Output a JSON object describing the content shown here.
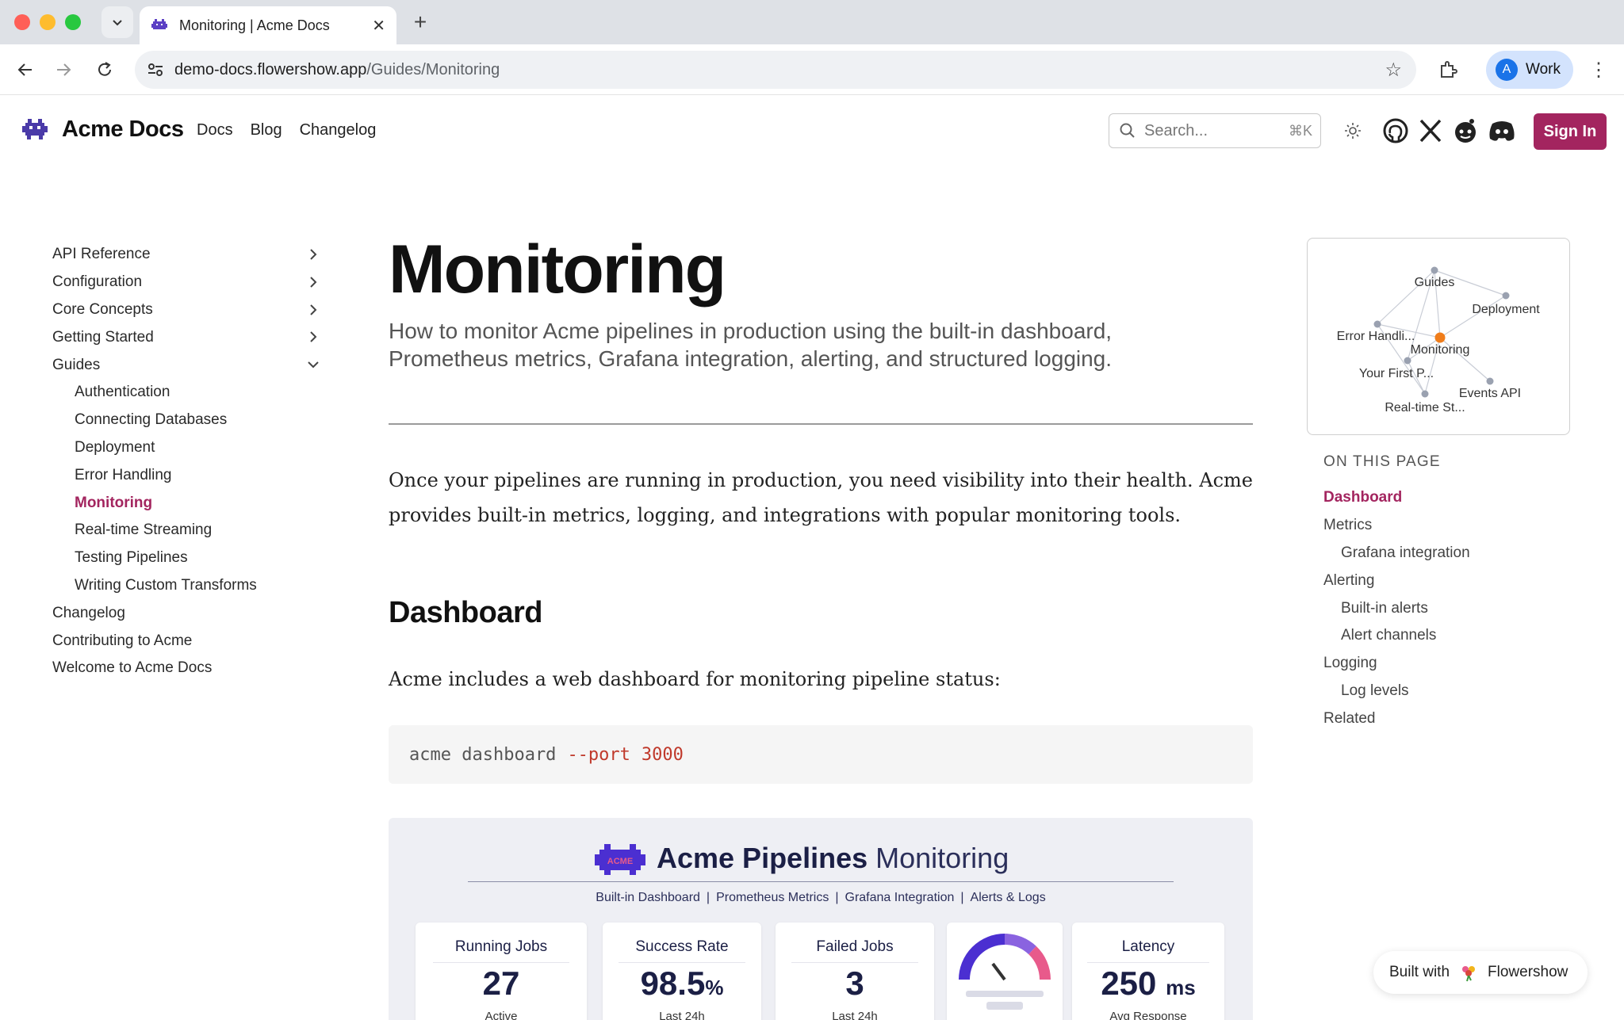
{
  "browser": {
    "tab_title": "Monitoring | Acme Docs",
    "url_host": "demo-docs.flowershow.app",
    "url_path": "/Guides/Monitoring",
    "profile_initial": "A",
    "profile_name": "Work"
  },
  "header": {
    "brand": "Acme Docs",
    "nav": [
      "Docs",
      "Blog",
      "Changelog"
    ],
    "search_placeholder": "Search...",
    "search_shortcut": "⌘K",
    "signin_label": "Sign In",
    "accent_color": "#a3255f"
  },
  "sidebar": {
    "items": [
      {
        "label": "API Reference",
        "chevron": "right"
      },
      {
        "label": "Configuration",
        "chevron": "right"
      },
      {
        "label": "Core Concepts",
        "chevron": "right"
      },
      {
        "label": "Getting Started",
        "chevron": "right"
      },
      {
        "label": "Guides",
        "chevron": "down"
      }
    ],
    "guides": [
      "Authentication",
      "Connecting Databases",
      "Deployment",
      "Error Handling",
      "Monitoring",
      "Real-time Streaming",
      "Testing Pipelines",
      "Writing Custom Transforms"
    ],
    "bottom": [
      "Changelog",
      "Contributing to Acme",
      "Welcome to Acme Docs"
    ]
  },
  "main": {
    "title": "Monitoring",
    "description": "How to monitor Acme pipelines in production using the built-in dashboard, Prometheus metrics, Grafana integration, alerting, and structured logging.",
    "lead": "Once your pipelines are running in production, you need visibility into their health. Acme provides built-in metrics, logging, and integrations with popular monitoring tools.",
    "h2_dashboard": "Dashboard",
    "dashboard_para": "Acme includes a web dashboard for monitoring pipeline status:",
    "code": {
      "cmd": "acme dashboard",
      "flag": "--port",
      "value": "3000"
    }
  },
  "banner": {
    "logo_text": "ACME",
    "title_bold": "Acme Pipelines",
    "title_rest": "Monitoring",
    "links": [
      "Built-in Dashboard",
      "Prometheus Metrics",
      "Grafana Integration",
      "Alerts & Logs"
    ],
    "cards": [
      {
        "title": "Running Jobs",
        "value": "27",
        "unit": "",
        "sub": "Active"
      },
      {
        "title": "Success Rate",
        "value": "98.5",
        "unit": "%",
        "sub": "Last 24h"
      },
      {
        "title": "Failed Jobs",
        "value": "3",
        "unit": "",
        "sub": "Last 24h"
      },
      {
        "title": "Latency",
        "value": "250",
        "unit": "ms",
        "sub": "Avg Response"
      }
    ]
  },
  "graph": {
    "nodes": [
      "Guides",
      "Deployment",
      "Error Handli...",
      "Monitoring",
      "Your First P...",
      "Events API",
      "Real-time St..."
    ]
  },
  "toc": {
    "heading": "ON THIS PAGE",
    "items": [
      {
        "label": "Dashboard",
        "level": 1
      },
      {
        "label": "Metrics",
        "level": 1
      },
      {
        "label": "Grafana integration",
        "level": 2
      },
      {
        "label": "Alerting",
        "level": 1
      },
      {
        "label": "Built-in alerts",
        "level": 2
      },
      {
        "label": "Alert channels",
        "level": 2
      },
      {
        "label": "Logging",
        "level": 1
      },
      {
        "label": "Log levels",
        "level": 2
      },
      {
        "label": "Related",
        "level": 1
      }
    ]
  },
  "footer_badge": {
    "prefix": "Built with",
    "name": "Flowershow"
  }
}
